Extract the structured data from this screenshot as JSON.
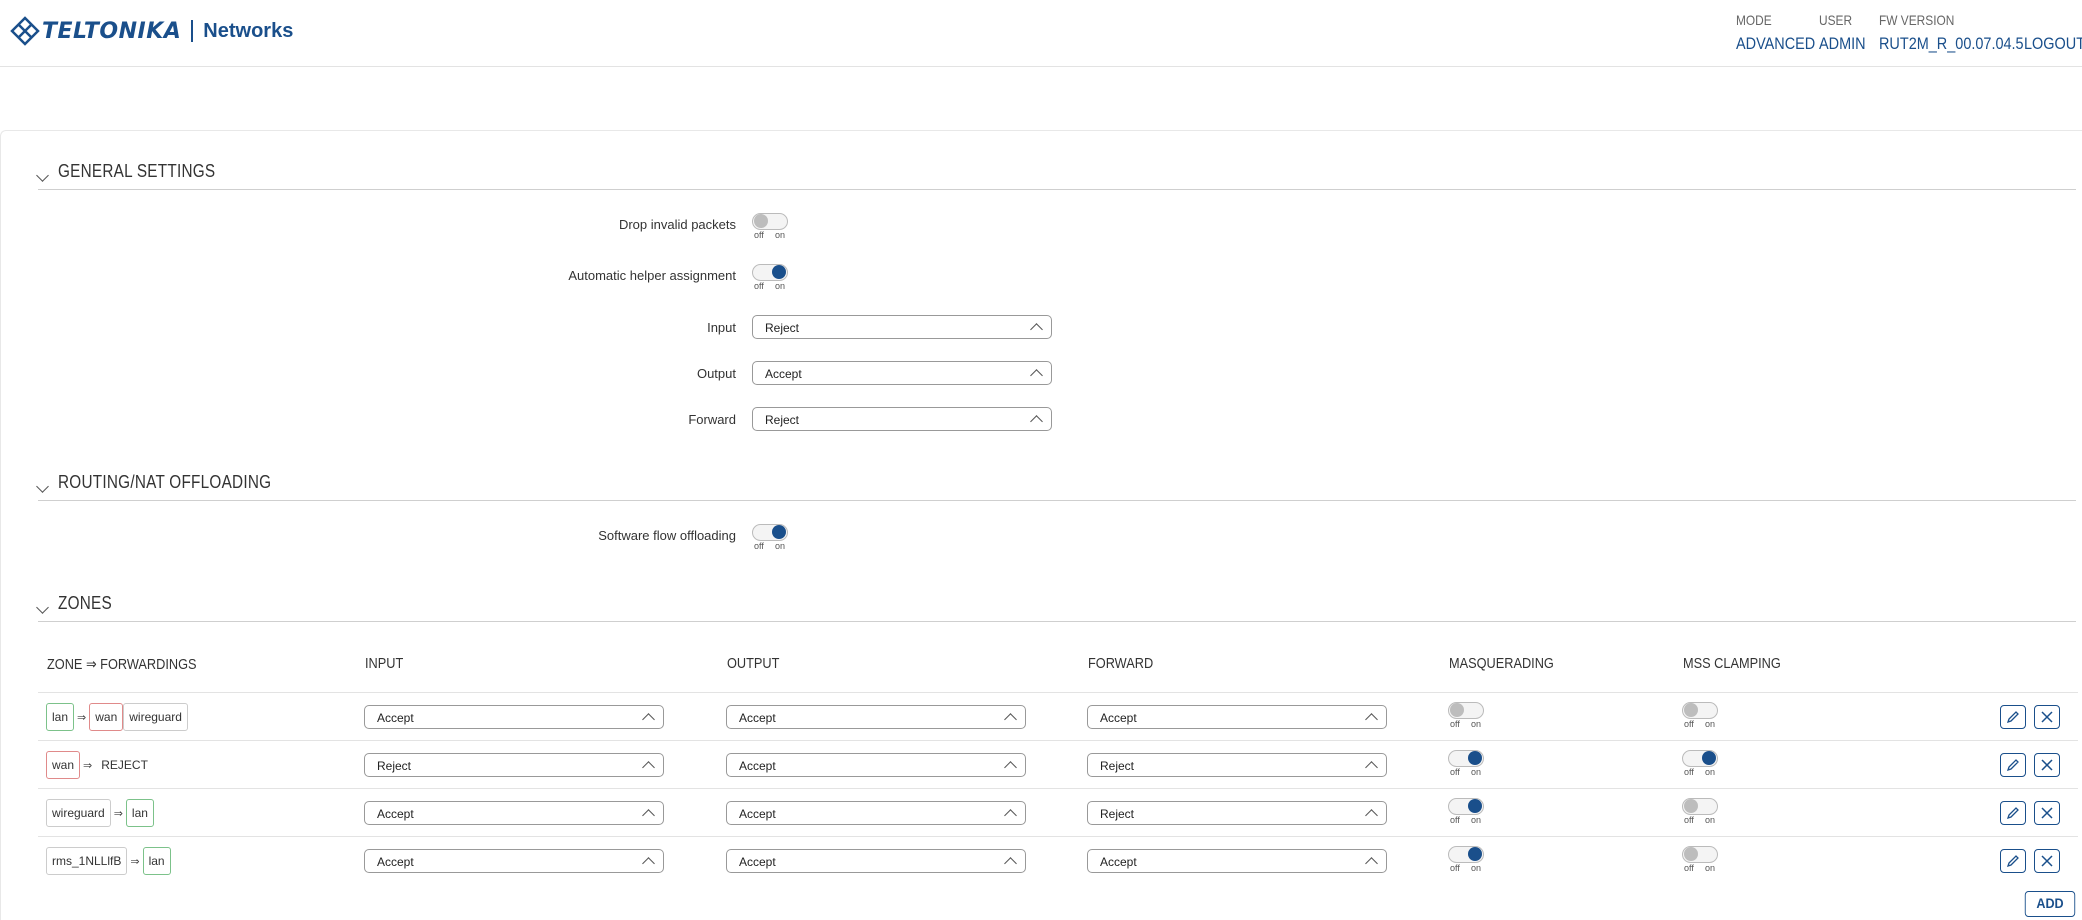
{
  "header": {
    "brand": "TELTONIKA",
    "networks": "Networks",
    "mode_label": "MODE",
    "mode_value": "ADVANCED",
    "user_label": "USER",
    "user_value": "ADMIN",
    "fw_label": "FW VERSION",
    "fw_value": "RUT2M_R_00.07.04.5",
    "logout": "LOGOUT"
  },
  "general": {
    "title": "GENERAL SETTINGS",
    "drop_invalid_label": "Drop invalid packets",
    "drop_invalid": "off",
    "auto_helper_label": "Automatic helper assignment",
    "auto_helper": "on",
    "input_label": "Input",
    "input_value": "Reject",
    "output_label": "Output",
    "output_value": "Accept",
    "forward_label": "Forward",
    "forward_value": "Reject"
  },
  "routing": {
    "title": "ROUTING/NAT OFFLOADING",
    "sfo_label": "Software flow offloading",
    "sfo": "on"
  },
  "toggle_text": {
    "off": "off",
    "on": "on"
  },
  "zones": {
    "title": "ZONES",
    "columns": {
      "zone": "ZONE ⇒ FORWARDINGS",
      "input": "INPUT",
      "output": "OUTPUT",
      "forward": "FORWARD",
      "masq": "MASQUERADING",
      "mss": "MSS CLAMPING"
    },
    "arrow": "⇒",
    "rows": [
      {
        "zone": "lan",
        "targets": [
          "wan",
          "wireguard"
        ],
        "input": "Accept",
        "output": "Accept",
        "forward": "Accept",
        "masq": "off",
        "mss": "off"
      },
      {
        "zone": "wan",
        "targets": [
          "REJECT"
        ],
        "input": "Reject",
        "output": "Accept",
        "forward": "Reject",
        "masq": "on",
        "mss": "on"
      },
      {
        "zone": "wireguard",
        "targets": [
          "lan"
        ],
        "input": "Accept",
        "output": "Accept",
        "forward": "Reject",
        "masq": "on",
        "mss": "off"
      },
      {
        "zone": "rms_1NLLlfB",
        "targets": [
          "lan"
        ],
        "input": "Accept",
        "output": "Accept",
        "forward": "Accept",
        "masq": "on",
        "mss": "off"
      }
    ],
    "add": "ADD"
  },
  "colors": {
    "accent": "#1a4f8b",
    "zone_green": "#7cc28a",
    "zone_red": "#e08a8a"
  },
  "icons": {
    "edit": "pencil-icon",
    "delete": "close-icon"
  }
}
